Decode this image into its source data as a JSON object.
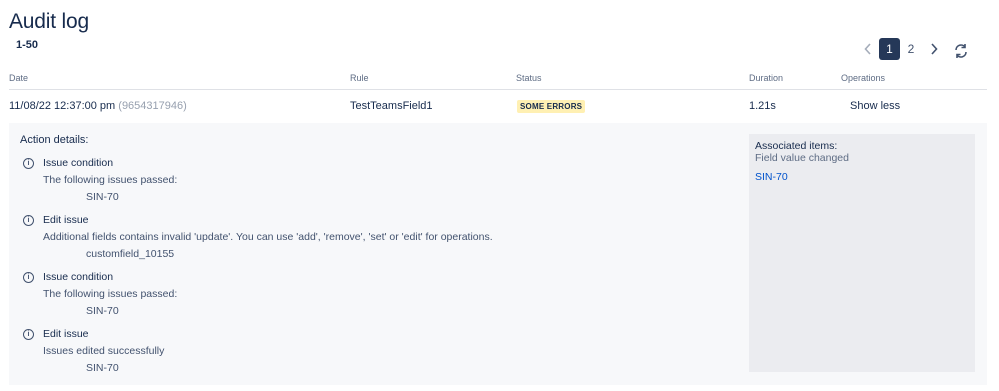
{
  "header": {
    "title": "Audit log",
    "range": "1-50"
  },
  "pagination": {
    "prev_icon": "chevron-left-icon",
    "pages": [
      "1",
      "2"
    ],
    "current": "1",
    "next_icon": "chevron-right-icon",
    "refresh_icon": "refresh-icon"
  },
  "table": {
    "columns": [
      "Date",
      "Rule",
      "Status",
      "Duration",
      "Operations"
    ],
    "rows": [
      {
        "date": "11/08/22 12:37:00 pm",
        "id": "(9654317946)",
        "rule": "TestTeamsField1",
        "status": "SOME ERRORS",
        "duration": "1.21s",
        "operation": "Show less"
      }
    ]
  },
  "details": {
    "title": "Action details:",
    "actions": [
      {
        "title": "Issue condition",
        "description": "The following issues passed:",
        "item": "SIN-70"
      },
      {
        "title": "Edit issue",
        "description": "Additional fields contains invalid 'update'. You can use 'add', 'remove', 'set' or 'edit' for operations.",
        "item": "customfield_10155"
      },
      {
        "title": "Issue condition",
        "description": "The following issues passed:",
        "item": "SIN-70"
      },
      {
        "title": "Edit issue",
        "description": "Issues edited successfully",
        "item": "SIN-70"
      }
    ],
    "associated": {
      "title": "Associated items:",
      "subtitle": "Field value changed",
      "link": "SIN-70"
    }
  },
  "colors": {
    "primary_text": "#172b4d",
    "secondary_text": "#42526e",
    "page_active": "#253858",
    "lozenge_bg": "#fff0b3",
    "link": "#0052cc",
    "details_bg": "#f7f8fa",
    "assoc_bg": "#ebecf0"
  }
}
